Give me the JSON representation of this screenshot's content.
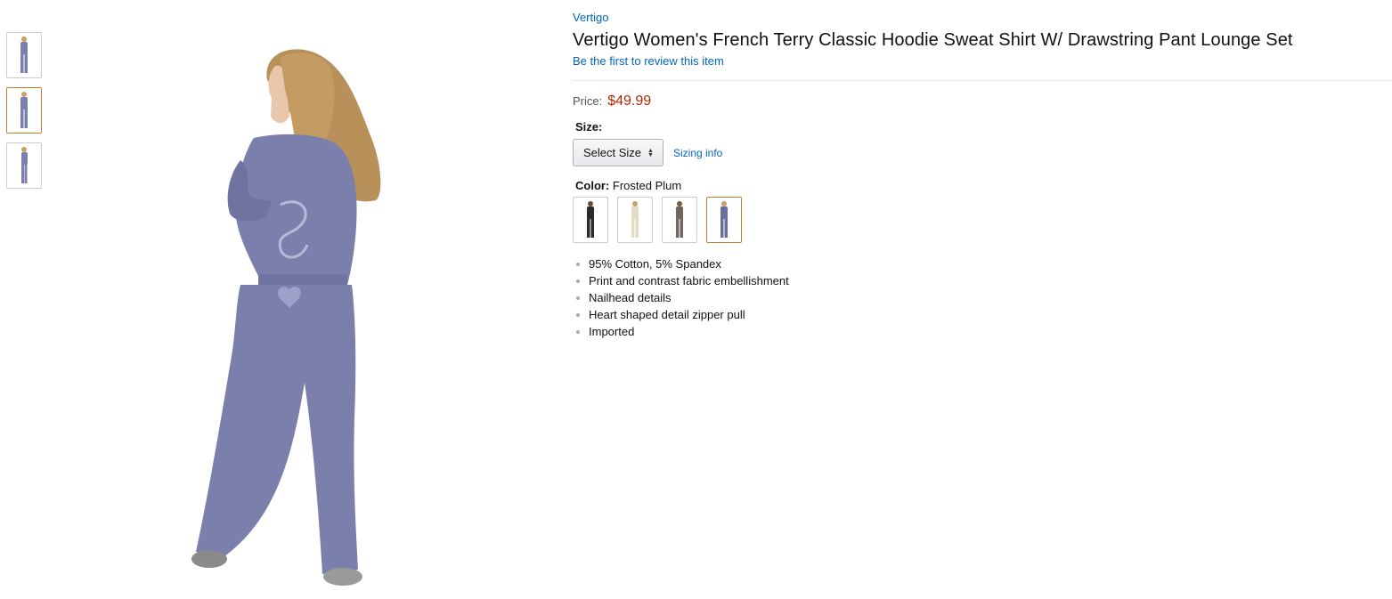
{
  "product": {
    "brand": "Vertigo",
    "title": "Vertigo Women's French Terry Classic Hoodie Sweat Shirt W/ Drawstring Pant Lounge Set",
    "review_link": "Be the first to review this item",
    "price_label": "Price:",
    "price_value": "$49.99",
    "size_label": "Size:",
    "size_select_value": "Select Size",
    "sizing_info": "Sizing info",
    "color_label": "Color:",
    "color_value": "Frosted Plum",
    "features": [
      "95% Cotton, 5% Spandex",
      "Print and contrast fabric embellishment",
      "Nailhead details",
      "Heart shaped detail zipper pull",
      "Imported"
    ]
  },
  "thumbnails": [
    {
      "name": "front-view",
      "selected": false
    },
    {
      "name": "back-view",
      "selected": true
    },
    {
      "name": "side-view",
      "selected": false
    }
  ],
  "color_swatches": [
    {
      "name": "black",
      "color": "#2b2b2b",
      "selected": false
    },
    {
      "name": "cream",
      "color": "#eeeadb",
      "selected": false
    },
    {
      "name": "taupe",
      "color": "#6f6660",
      "selected": false
    },
    {
      "name": "frosted-plum",
      "color": "#6b6f9e",
      "selected": true
    }
  ],
  "colors": {
    "link": "#0066c0",
    "price": "#b12704",
    "selected_border": "#c57b2e",
    "outfit": "#7b7fab",
    "hair": "#b8905a",
    "skin": "#e9c7ad"
  }
}
